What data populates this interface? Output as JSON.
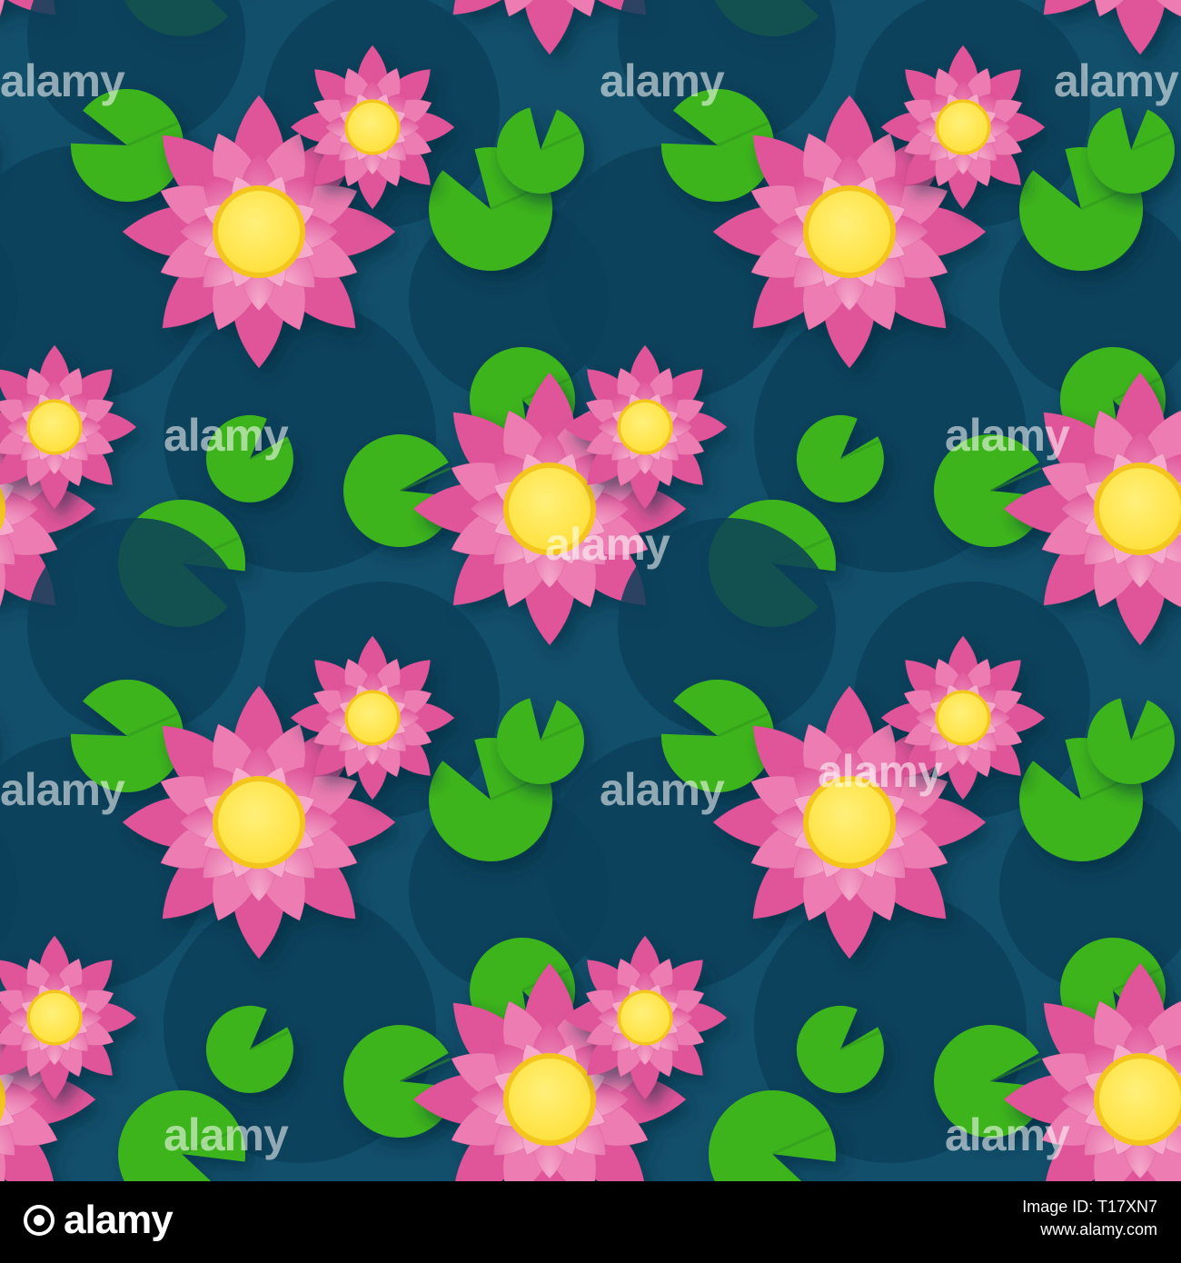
{
  "image": {
    "subject": "seamless pattern",
    "colors": {
      "water": "#124f6b",
      "water_shadow": "#0c3f59",
      "lily_pad": "#3cb41e",
      "lily_pad_dark": "#2f8f17",
      "petal_outer": "#e0559a",
      "petal_mid": "#ec7bb1",
      "petal_inner": "#f6a9cc",
      "flower_center": "#ffe03a",
      "flower_center_rim": "#f4c51a"
    }
  },
  "watermark": {
    "text": "alamy",
    "count": 11
  },
  "footer": {
    "logo_text": "alamy",
    "image_id_label": "Image ID:",
    "image_id": "T17XN7",
    "url": "www.alamy.com"
  }
}
